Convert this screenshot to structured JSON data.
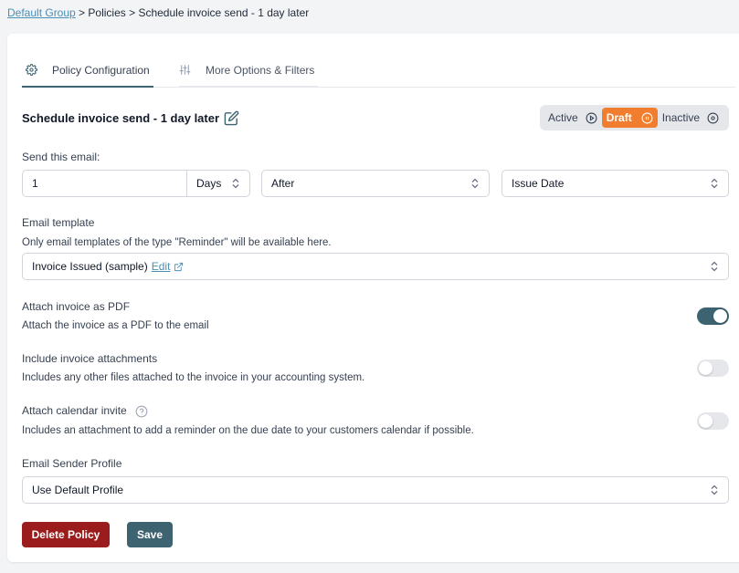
{
  "breadcrumb": {
    "root": "Default Group",
    "sep1": " > ",
    "policies": "Policies",
    "sep2": " > ",
    "current": "Schedule invoice send - 1 day later"
  },
  "tabs": [
    {
      "label": "Policy Configuration",
      "icon": "gear-icon",
      "active": true
    },
    {
      "label": "More Options & Filters",
      "icon": "sliders-icon",
      "active": false
    }
  ],
  "policy": {
    "title": "Schedule invoice send - 1 day later"
  },
  "status": {
    "active": "Active",
    "draft": "Draft",
    "inactive": "Inactive",
    "selected": "Draft",
    "accent": "#f07e2e"
  },
  "send": {
    "label": "Send this email:",
    "amount": "1",
    "unit": "Days",
    "relation": "After",
    "reference": "Issue Date"
  },
  "template": {
    "label": "Email template",
    "description": "Only email templates of the type \"Reminder\" will be available here.",
    "value": "Invoice Issued (sample)",
    "edit_label": "Edit"
  },
  "options": {
    "attach_pdf": {
      "label": "Attach invoice as PDF",
      "description": "Attach the invoice as a PDF to the email",
      "enabled": true
    },
    "attachments": {
      "label": "Include invoice attachments",
      "description": "Includes any other files attached to the invoice in your accounting system.",
      "enabled": false
    },
    "calendar": {
      "label": "Attach calendar invite",
      "description": "Includes an attachment to add a reminder on the due date to your customers calendar if possible.",
      "enabled": false
    }
  },
  "sender": {
    "label": "Email Sender Profile",
    "value": "Use Default Profile"
  },
  "actions": {
    "delete_label": "Delete Policy",
    "save_label": "Save",
    "delete_color": "#9b1c1c",
    "primary_color": "#3d6270"
  }
}
